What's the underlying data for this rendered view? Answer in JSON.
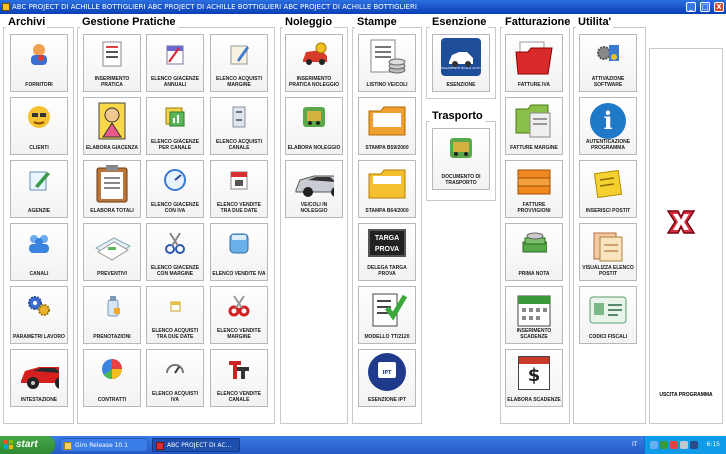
{
  "window": {
    "title": "ABC PROJECT DI ACHILLE BOTTIGLIERI ABC PROJECT DI ACHILLE BOTTIGLIERI ABC PROJECT DI ACHILLE BOTTIGLIERI",
    "minimize": "_",
    "maximize": "□",
    "close": "X"
  },
  "sections": {
    "archivi": "Archivi",
    "gestione": "Gestione Pratiche",
    "noleggio": "Noleggio",
    "stampe": "Stampe",
    "esenzione": "Esenzione",
    "trasporto": "Trasporto",
    "fatturazione": "Fatturazione",
    "utilita": "Utilita'"
  },
  "archivi": {
    "fornitori": "FORNITORI",
    "clienti": "CLIENTI",
    "agenzie": "AGENZIE",
    "canali": "CANALI",
    "parametri": "PARAMETRI LAVORO",
    "intestazione": "INTESTAZIONE"
  },
  "gestione": {
    "inserimento": "INSERIMENTO PRATICA",
    "giacenze_annuali": "ELENCO GIACENZE ANNUALI",
    "acquisti_margine": "ELENCO ACQUISTI MARGINE",
    "elabora_giacenza": "ELABORA GIACENZA",
    "giacenze_canale": "ELENCO GIACENZE PER CANALE",
    "acquisti_canale": "ELENCO ACQUISTI CANALE",
    "elabora_totali": "ELABORA TOTALI",
    "giacenze_iva": "ELENCO GIACENZE CON IVA",
    "vendite_date": "ELENCO VENDITE TRA DUE DATE",
    "preventivi": "PREVENTIVI",
    "giacenze_margine": "ELENCO GIACENZE CON MARGINE",
    "vendite_iva": "ELENCO VENDITE IVA",
    "prenotazioni": "PRENOTAZIONI",
    "acquisti_date": "ELENCO ACQUISTI TRA DUE DATE",
    "vendite_margine": "ELENCO VENDITE MARGINE",
    "contratti": "CONTRATTI",
    "acquisti_iva": "ELENCO ACQUISTI IVA",
    "vendite_canale": "ELENCO VENDITE CANALE"
  },
  "noleggio": {
    "inserimento": "INSERIMENTO PRATICA NOLEGGIO",
    "elabora": "ELABORA NOLEGGIO",
    "veicoli": "VEICOLI IN NOLEGGIO"
  },
  "stampe": {
    "listino": "LISTINO VEICOLI",
    "b59": "STAMPA B59/2000",
    "b64": "STAMPA B64/2000",
    "targa_icon": "TARGA PROVA",
    "delega": "DELEGA TARGA PROVA",
    "tt2120": "MODELLO TT/2120",
    "ipt_icon": "IPT",
    "esenzione_ipt": "ESENZIONE IPT"
  },
  "esenzione": {
    "icon_text": "PAGAMENTO BOLLO AUTO",
    "label": "ESENZIONE"
  },
  "trasporto": {
    "label": "DOCUMENTO DI TRASPORTO"
  },
  "fatturazione": {
    "iva": "FATTURE IVA",
    "margine": "FATTURE MARGINE",
    "provvigioni": "FATTURE PROVVIGIONI",
    "prima_nota": "PRIMA NOTA",
    "scadenze": "INSERIMENTO SCADENZE",
    "elabora_scadenze": "ELABORA SCADENZE",
    "dollar": "$"
  },
  "utilita": {
    "attivazione": "ATTIVAZIONE SOFTWARE",
    "autenticazione": "AUTENTICAZIONE PROGRAMMA",
    "inserisci_postit": "INSERISCI POSTIT",
    "visualizza_postit": "VISUALIZZA ELENCO POSTIT",
    "codici": "CODICI FISCALI"
  },
  "uscita": "USCITA PROGRAMMA",
  "taskbar": {
    "start": "start",
    "task1": "Giro Release 10.1",
    "task2": "ABC PROJECT DI AC...",
    "lang": "IT",
    "clock": "6:15"
  }
}
